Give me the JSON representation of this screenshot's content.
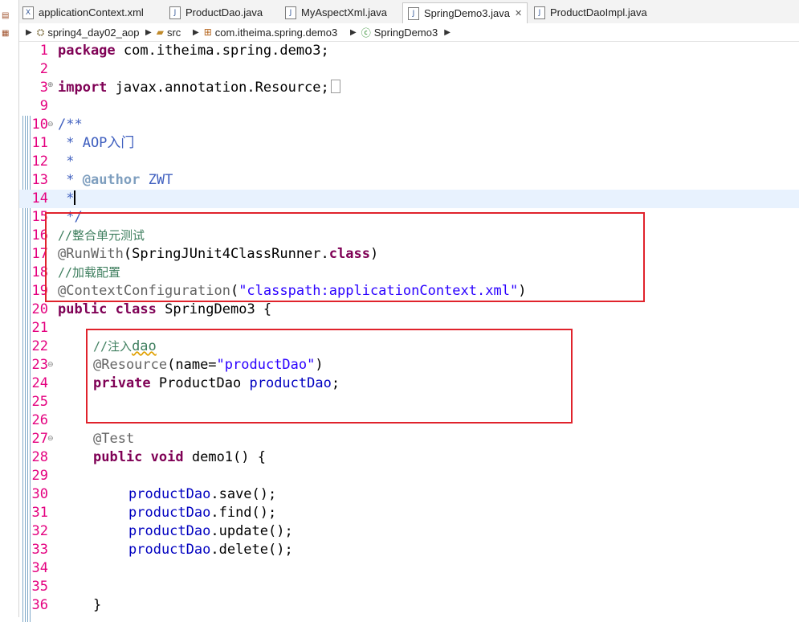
{
  "tabs": [
    {
      "label": "applicationContext.xml",
      "icon": "xml-file-icon",
      "active": false
    },
    {
      "label": "ProductDao.java",
      "icon": "java-file-icon",
      "active": false
    },
    {
      "label": "MyAspectXml.java",
      "icon": "java-file-icon",
      "active": false
    },
    {
      "label": "SpringDemo3.java",
      "icon": "java-file-icon",
      "active": true,
      "close": "✕"
    },
    {
      "label": "ProductDaoImpl.java",
      "icon": "java-file-icon",
      "active": false
    }
  ],
  "breadcrumb": {
    "project": "spring4_day02_aop",
    "folder": "src",
    "package": "com.itheima.spring.demo3",
    "class": "SpringDemo3"
  },
  "editor": {
    "line_numbers": [
      "1",
      "2",
      "3",
      "9",
      "10",
      "11",
      "12",
      "13",
      "14",
      "15",
      "16",
      "17",
      "18",
      "19",
      "20",
      "21",
      "22",
      "23",
      "24",
      "25",
      "26",
      "27",
      "28",
      "29",
      "30",
      "31",
      "32",
      "33",
      "34",
      "35",
      "36"
    ],
    "lines": {
      "l1_kw": "package",
      "l1_rest": " com.itheima.spring.demo3;",
      "l3_kw": "import",
      "l3_rest": " javax.annotation.Resource;",
      "l10": "/**",
      "l11": " * AOP入门",
      "l12": " *",
      "l13_a": " * ",
      "l13_tag": "@author",
      "l13_b": " ZWT",
      "l14": " *",
      "l15": " */",
      "l16": "//整合单元测试",
      "l17_an": "@RunWith",
      "l17_a": "(SpringJUnit4ClassRunner.",
      "l17_kw": "class",
      "l17_b": ")",
      "l18": "//加载配置",
      "l19_an": "@ContextConfiguration",
      "l19_a": "(",
      "l19_str": "\"classpath:applicationContext.xml\"",
      "l19_b": ")",
      "l20_kw1": "public",
      "l20_kw2": "class",
      "l20_rest": " SpringDemo3 {",
      "l22_a": "//注入",
      "l22_b": "dao",
      "l23_an": "@Resource",
      "l23_a": "(name=",
      "l23_str": "\"productDao\"",
      "l23_b": ")",
      "l24_kw": "private",
      "l24_a": " ProductDao ",
      "l24_fld": "productDao",
      "l24_b": ";",
      "l27_an": "@Test",
      "l28_kw1": "public",
      "l28_kw2": "void",
      "l28_rest": " demo1() {",
      "l30_fld": "productDao",
      "l30_rest": ".save();",
      "l31_fld": "productDao",
      "l31_rest": ".find();",
      "l32_fld": "productDao",
      "l32_rest": ".update();",
      "l33_fld": "productDao",
      "l33_rest": ".delete();",
      "l36": "}"
    }
  },
  "colors": {
    "highlight_box": "#e0232c",
    "line_number": "#e4007f",
    "keyword": "#7f0055",
    "comment": "#3f7f5f",
    "javadoc": "#3f5fbf",
    "string": "#2a00ff",
    "field": "#0000c0",
    "annotation": "#646464"
  }
}
